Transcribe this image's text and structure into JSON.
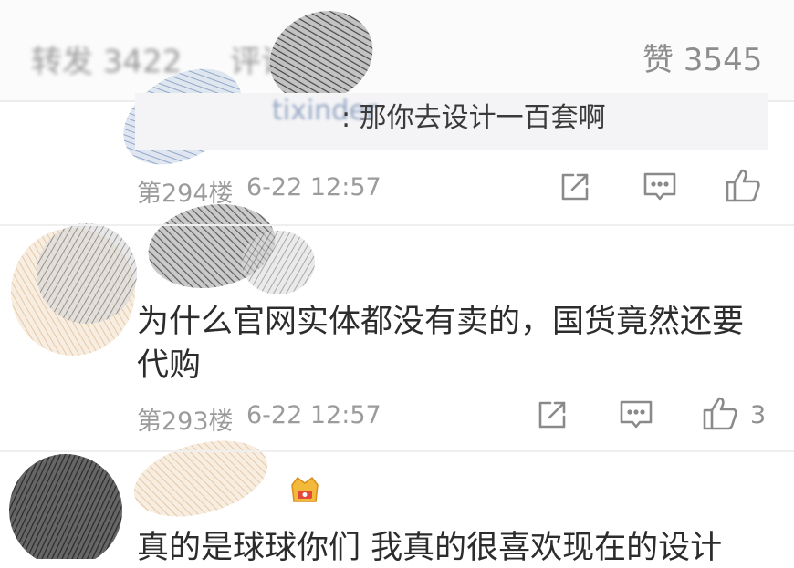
{
  "header": {
    "tabs": [
      {
        "label": "转发 3422"
      },
      {
        "label": "评论"
      }
    ],
    "like_tab": "赞 3545"
  },
  "comments": [
    {
      "quote_user": "tixinder",
      "quote_text": ": 那你去设计一百套啊",
      "floor": "第294楼",
      "time": "6-22 12:57",
      "like_count": ""
    },
    {
      "text_line1": "为什么官网实体都没有卖的，国货竟然还要",
      "text_line2": "代购",
      "floor": "第293楼",
      "time": "6-22 12:57",
      "like_count": "3"
    },
    {
      "text_line1": "真的是球球你们 我真的很喜欢现在的设计"
    }
  ],
  "icons": [
    "share-icon",
    "comment-icon",
    "like-icon",
    "badge-icon"
  ],
  "colors": {
    "meta": "#9b9b9b",
    "text": "#2c2c2c",
    "icon": "#8a8a8a",
    "quote_bg": "#f4f4f6"
  }
}
